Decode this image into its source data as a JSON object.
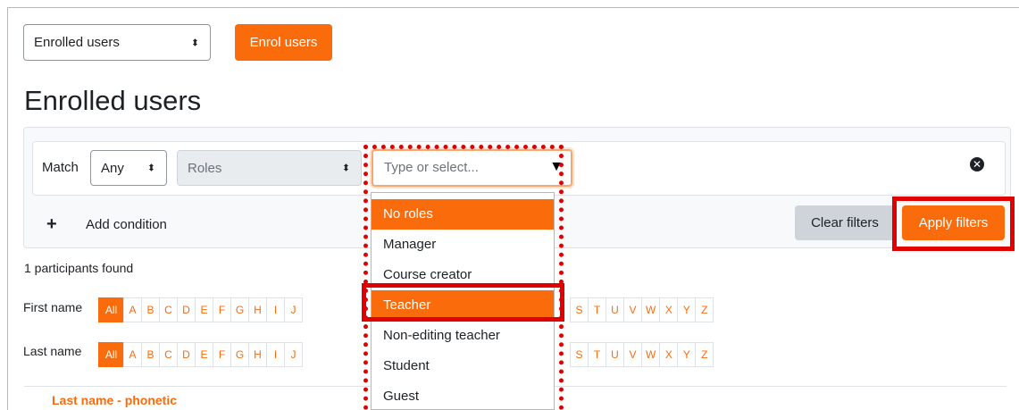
{
  "top": {
    "view_select": "Enrolled users",
    "enrol_button": "Enrol users"
  },
  "page_title": "Enrolled users",
  "filter": {
    "match_label": "Match",
    "match_value": "Any",
    "type_value": "Roles",
    "autocomplete_placeholder": "Type or select...",
    "add_condition": "Add condition",
    "clear_filters": "Clear filters",
    "apply_filters": "Apply filters"
  },
  "participants_found": "1 participants found",
  "initials_bar": {
    "first_name_label": "First name",
    "last_name_label": "Last name",
    "all_label": "All",
    "letters_left": [
      "A",
      "B",
      "C",
      "D",
      "E",
      "F",
      "G",
      "H",
      "I",
      "J"
    ],
    "letters_right": [
      "S",
      "T",
      "U",
      "V",
      "W",
      "X",
      "Y",
      "Z"
    ]
  },
  "table": {
    "column_header": "Last name - phonetic"
  },
  "role_options": [
    "No roles",
    "Manager",
    "Course creator",
    "Teacher",
    "Non-editing teacher",
    "Student",
    "Guest"
  ],
  "colors": {
    "accent": "#f96b0b",
    "annotation": "#e00000"
  }
}
